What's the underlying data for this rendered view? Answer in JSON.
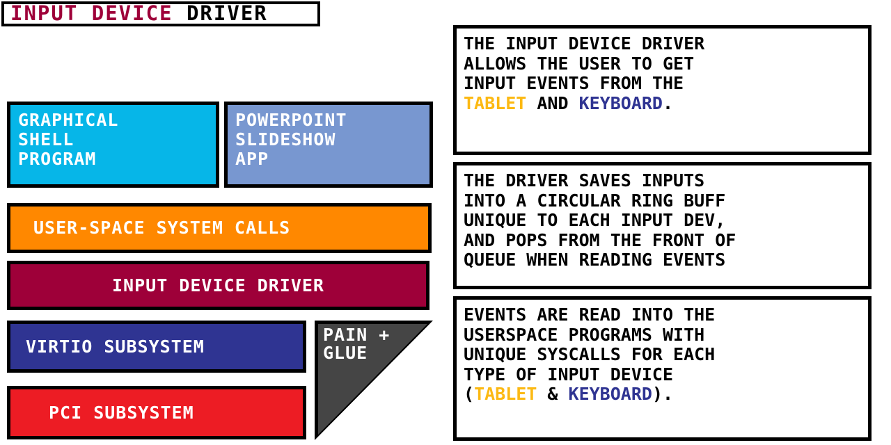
{
  "title": {
    "part_red": "INPUT DEVICE",
    "part_black": " DRIVER"
  },
  "colors": {
    "title_red": "#9E0039",
    "graphical_shell_cyan": "#06B6E8",
    "powerpoint_blue_gray": "#7897D0",
    "syscalls_orange": "#FF8800",
    "driver_dark_red": "#9E0039",
    "virtio_blue": "#2F3492",
    "pci_red": "#ED1C24",
    "pain_glue_gray": "#454545",
    "tablet_amber": "#FCB913",
    "keyboard_blue": "#2F3492",
    "border_black": "#000000",
    "text_white": "#FFFFFF"
  },
  "stack": {
    "graphical_shell": {
      "line1": "GRAPHICAL",
      "line2": "SHELL",
      "line3": "PROGRAM"
    },
    "powerpoint": {
      "line1": "POWERPOINT",
      "line2": "SLIDESHOW",
      "line3": "APP"
    },
    "syscalls": "USER-SPACE SYSTEM CALLS",
    "driver": "INPUT DEVICE DRIVER",
    "virtio": "VIRTIO SUBSYSTEM",
    "pci": "PCI SUBSYSTEM"
  },
  "pain_glue": {
    "line1": "PAIN +",
    "line2": "GLUE"
  },
  "notes": [
    {
      "id": "note-1",
      "lines": [
        {
          "segments": [
            {
              "text": "THE INPUT DEVICE DRIVER",
              "style": "plain"
            }
          ]
        },
        {
          "segments": [
            {
              "text": "ALLOWS THE USER TO GET",
              "style": "plain"
            }
          ]
        },
        {
          "segments": [
            {
              "text": "INPUT EVENTS FROM THE",
              "style": "plain"
            }
          ]
        },
        {
          "segments": [
            {
              "text": "TABLET",
              "style": "tablet"
            },
            {
              "text": " AND ",
              "style": "plain"
            },
            {
              "text": "KEYBOARD",
              "style": "keyboard"
            },
            {
              "text": ".",
              "style": "plain"
            }
          ]
        }
      ]
    },
    {
      "id": "note-2",
      "lines": [
        {
          "segments": [
            {
              "text": "THE DRIVER SAVES INPUTS",
              "style": "plain"
            }
          ]
        },
        {
          "segments": [
            {
              "text": "INTO A CIRCULAR RING BUFF",
              "style": "plain"
            }
          ]
        },
        {
          "segments": [
            {
              "text": "UNIQUE TO EACH INPUT DEV,",
              "style": "plain"
            }
          ]
        },
        {
          "segments": [
            {
              "text": "AND POPS FROM THE FRONT OF",
              "style": "plain"
            }
          ]
        },
        {
          "segments": [
            {
              "text": "QUEUE WHEN READING EVENTS",
              "style": "plain"
            }
          ]
        }
      ]
    },
    {
      "id": "note-3",
      "lines": [
        {
          "segments": [
            {
              "text": "EVENTS ARE READ INTO THE",
              "style": "plain"
            }
          ]
        },
        {
          "segments": [
            {
              "text": "USERSPACE PROGRAMS WITH",
              "style": "plain"
            }
          ]
        },
        {
          "segments": [
            {
              "text": "UNIQUE SYSCALLS FOR EACH",
              "style": "plain"
            }
          ]
        },
        {
          "segments": [
            {
              "text": "TYPE OF INPUT DEVICE",
              "style": "plain"
            }
          ]
        },
        {
          "segments": [
            {
              "text": "(",
              "style": "plain"
            },
            {
              "text": "TABLET",
              "style": "tablet"
            },
            {
              "text": " & ",
              "style": "plain"
            },
            {
              "text": "KEYBOARD",
              "style": "keyboard"
            },
            {
              "text": ").",
              "style": "plain"
            }
          ]
        }
      ]
    }
  ]
}
